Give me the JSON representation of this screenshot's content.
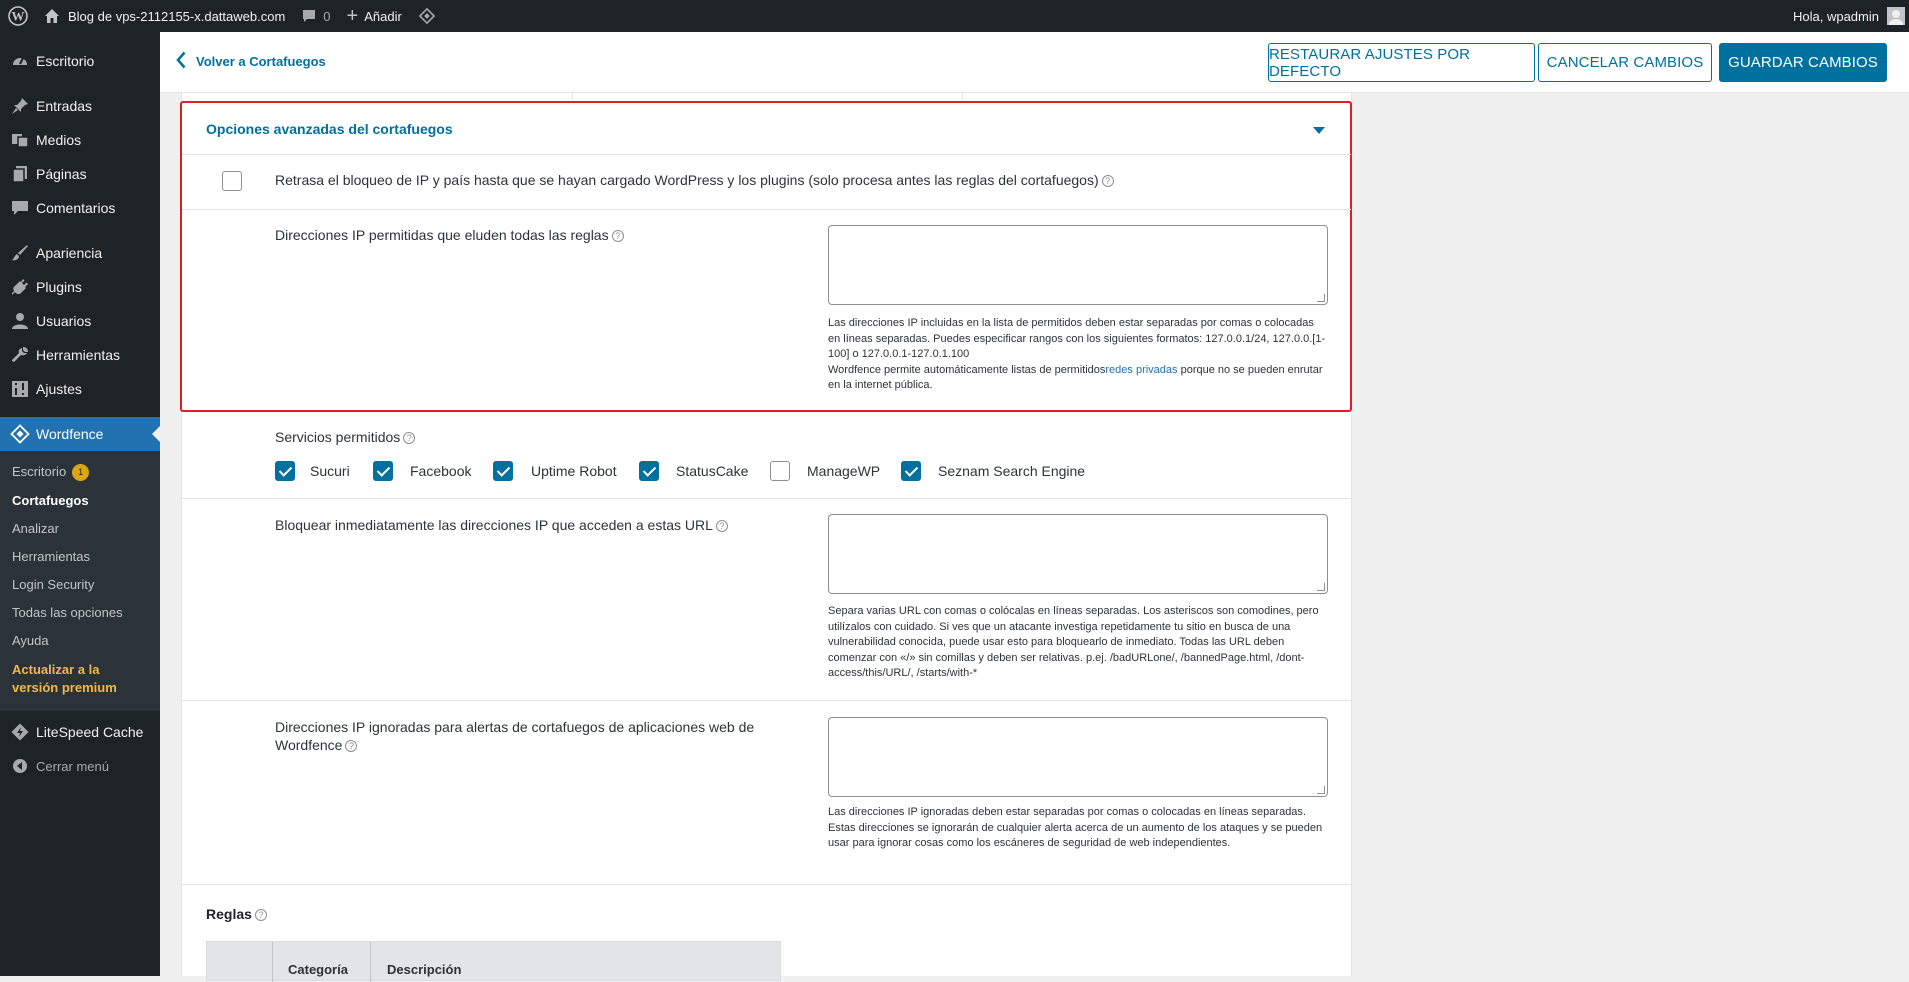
{
  "adminbar": {
    "site_title": "Blog de vps-2112155-x.dattaweb.com",
    "comments_count": "0",
    "add_new": "Añadir",
    "greeting": "Hola, wpadmin"
  },
  "sidebar": {
    "items": [
      {
        "label": "Escritorio",
        "icon": "dashboard-icon"
      },
      {
        "label": "Entradas",
        "icon": "pin-icon"
      },
      {
        "label": "Medios",
        "icon": "media-icon"
      },
      {
        "label": "Páginas",
        "icon": "pages-icon"
      },
      {
        "label": "Comentarios",
        "icon": "comments-icon"
      },
      {
        "label": "Apariencia",
        "icon": "brush-icon"
      },
      {
        "label": "Plugins",
        "icon": "plugin-icon"
      },
      {
        "label": "Usuarios",
        "icon": "user-icon"
      },
      {
        "label": "Herramientas",
        "icon": "wrench-icon"
      },
      {
        "label": "Ajustes",
        "icon": "settings-icon"
      },
      {
        "label": "Wordfence",
        "icon": "wordfence-icon"
      }
    ],
    "submenu": [
      {
        "label": "Escritorio",
        "badge": "1"
      },
      {
        "label": "Cortafuegos"
      },
      {
        "label": "Analizar"
      },
      {
        "label": "Herramientas"
      },
      {
        "label": "Login Security"
      },
      {
        "label": "Todas las opciones"
      },
      {
        "label": "Ayuda"
      },
      {
        "label": "Actualizar a la versión premium"
      }
    ],
    "litespeed": "LiteSpeed Cache",
    "collapse": "Cerrar menú"
  },
  "topbar": {
    "back": "Volver a Cortafuegos",
    "restore": "RESTAURAR AJUSTES POR DEFECTO",
    "cancel": "CANCELAR CAMBIOS",
    "save": "GUARDAR CAMBIOS"
  },
  "advanced": {
    "title": "Opciones avanzadas del cortafuegos",
    "delay_label": "Retrasa el bloqueo de IP y país hasta que se hayan cargado WordPress y los plugins (solo procesa antes las reglas del cortafuegos)",
    "allowlist_label": "Direcciones IP permitidas que eluden todas las reglas",
    "allowlist_hint_1": "Las direcciones IP incluidas en la lista de permitidos deben estar separadas por comas o colocadas en líneas separadas. Puedes especificar rangos con los siguientes formatos: 127.0.0.1/24, 127.0.0.[1-100] o 127.0.0.1-127.0.1.100",
    "allowlist_hint_2": "Wordfence permite automáticamente listas de permitidos",
    "allowlist_hint_link": "redes privadas",
    "allowlist_hint_3": " porque no se pueden enrutar en la internet pública.",
    "services_label": "Servicios permitidos",
    "services": [
      {
        "name": "Sucuri",
        "checked": true
      },
      {
        "name": "Facebook",
        "checked": true
      },
      {
        "name": "Uptime Robot",
        "checked": true
      },
      {
        "name": "StatusCake",
        "checked": true
      },
      {
        "name": "ManageWP",
        "checked": false
      },
      {
        "name": "Seznam Search Engine",
        "checked": true
      }
    ],
    "block_url_label": "Bloquear inmediatamente las direcciones IP que acceden a estas URL",
    "block_url_hint": "Separa varias URL con comas o colócalas en líneas separadas. Los asteriscos son comodines, pero utilízalos con cuidado. Si ves que un atacante investiga repetidamente tu sitio en busca de una vulnerabilidad conocida, puede usar esto para bloquearlo de inmediato. Todas las URL deben comenzar con «/» sin comillas y deben ser relativas. p.ej. /badURLone/, /bannedPage.html, /dont-access/this/URL/, /starts/with-*",
    "ignored_label": "Direcciones IP ignoradas para alertas de cortafuegos de aplicaciones web de Wordfence",
    "ignored_hint": "Las direcciones IP ignoradas deben estar separadas por comas o colocadas en líneas separadas. Estas direcciones se ignorarán de cualquier alerta acerca de un aumento de los ataques y se pueden usar para ignorar cosas como los escáneres de seguridad de web independientes."
  },
  "rules": {
    "title": "Reglas",
    "columns": [
      "Categoría",
      "Descripción"
    ]
  },
  "colors": {
    "accent": "#00709e",
    "sidebar_bg": "#1d2327",
    "highlight": "#e11d2a"
  }
}
